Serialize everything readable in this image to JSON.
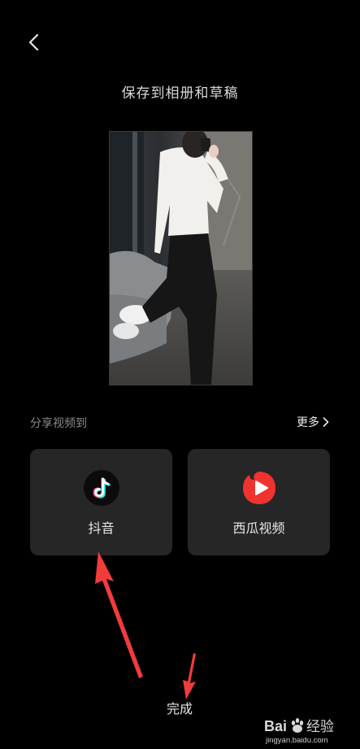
{
  "header": {
    "back_icon": "chevron-left-icon",
    "title": "保存到相册和草稿"
  },
  "preview": {
    "description_icon": "video-thumbnail"
  },
  "share": {
    "label": "分享视频到",
    "more_label": "更多",
    "more_icon": "chevron-right-icon",
    "targets": [
      {
        "label": "抖音",
        "icon": "douyin-icon",
        "color": "#000000"
      },
      {
        "label": "西瓜视频",
        "icon": "xigua-video-icon",
        "color": "#f0332f"
      }
    ]
  },
  "footer": {
    "done_label": "完成"
  },
  "annotation": {
    "arrow_color": "#f23b3b"
  },
  "watermark": {
    "brand_text": "Bai经验",
    "url": "jingyan.baidu.com"
  }
}
